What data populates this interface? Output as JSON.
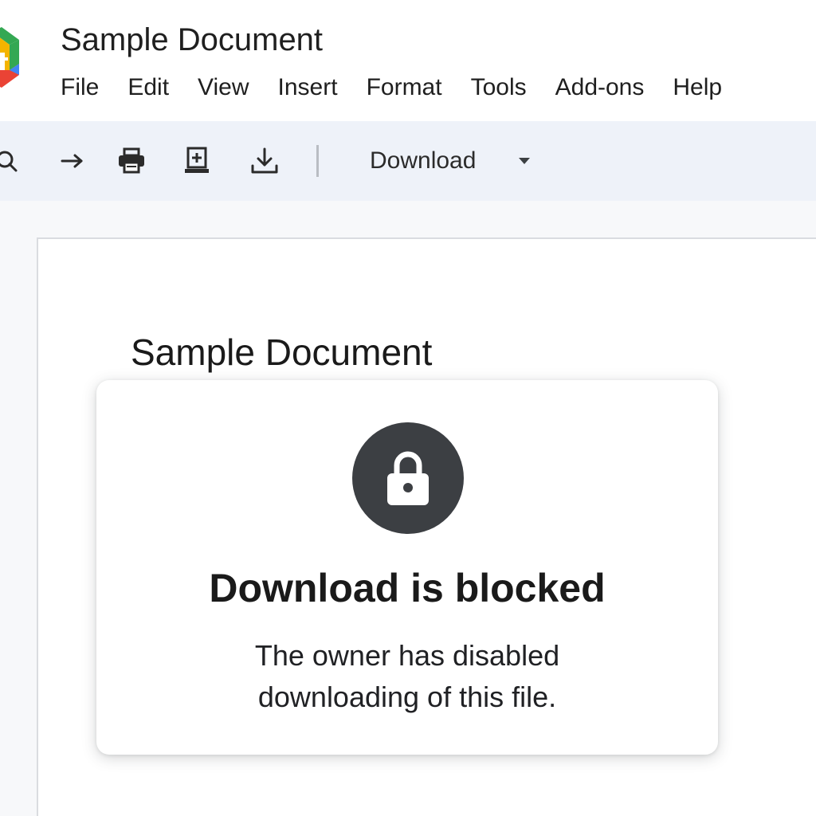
{
  "header": {
    "title": "Sample Document",
    "logo_icon": "docs-logo-icon"
  },
  "menubar": {
    "items": [
      "File",
      "Edit",
      "View",
      "Insert",
      "Format",
      "Tools",
      "Add-ons",
      "Help"
    ]
  },
  "toolbar": {
    "icons": [
      "search-icon",
      "arrow-right-icon",
      "print-icon",
      "add-to-drive-icon",
      "download-icon"
    ],
    "download_label": "Download",
    "dropdown_icon": "caret-down-icon",
    "background": "#eef2f9"
  },
  "page": {
    "heading": "Sample Document"
  },
  "dialog": {
    "icon": "lock-icon",
    "title": "Download is blocked",
    "message_line1": "The owner has disabled",
    "message_line2": "downloading of this file.",
    "icon_background": "#3c3f43"
  }
}
